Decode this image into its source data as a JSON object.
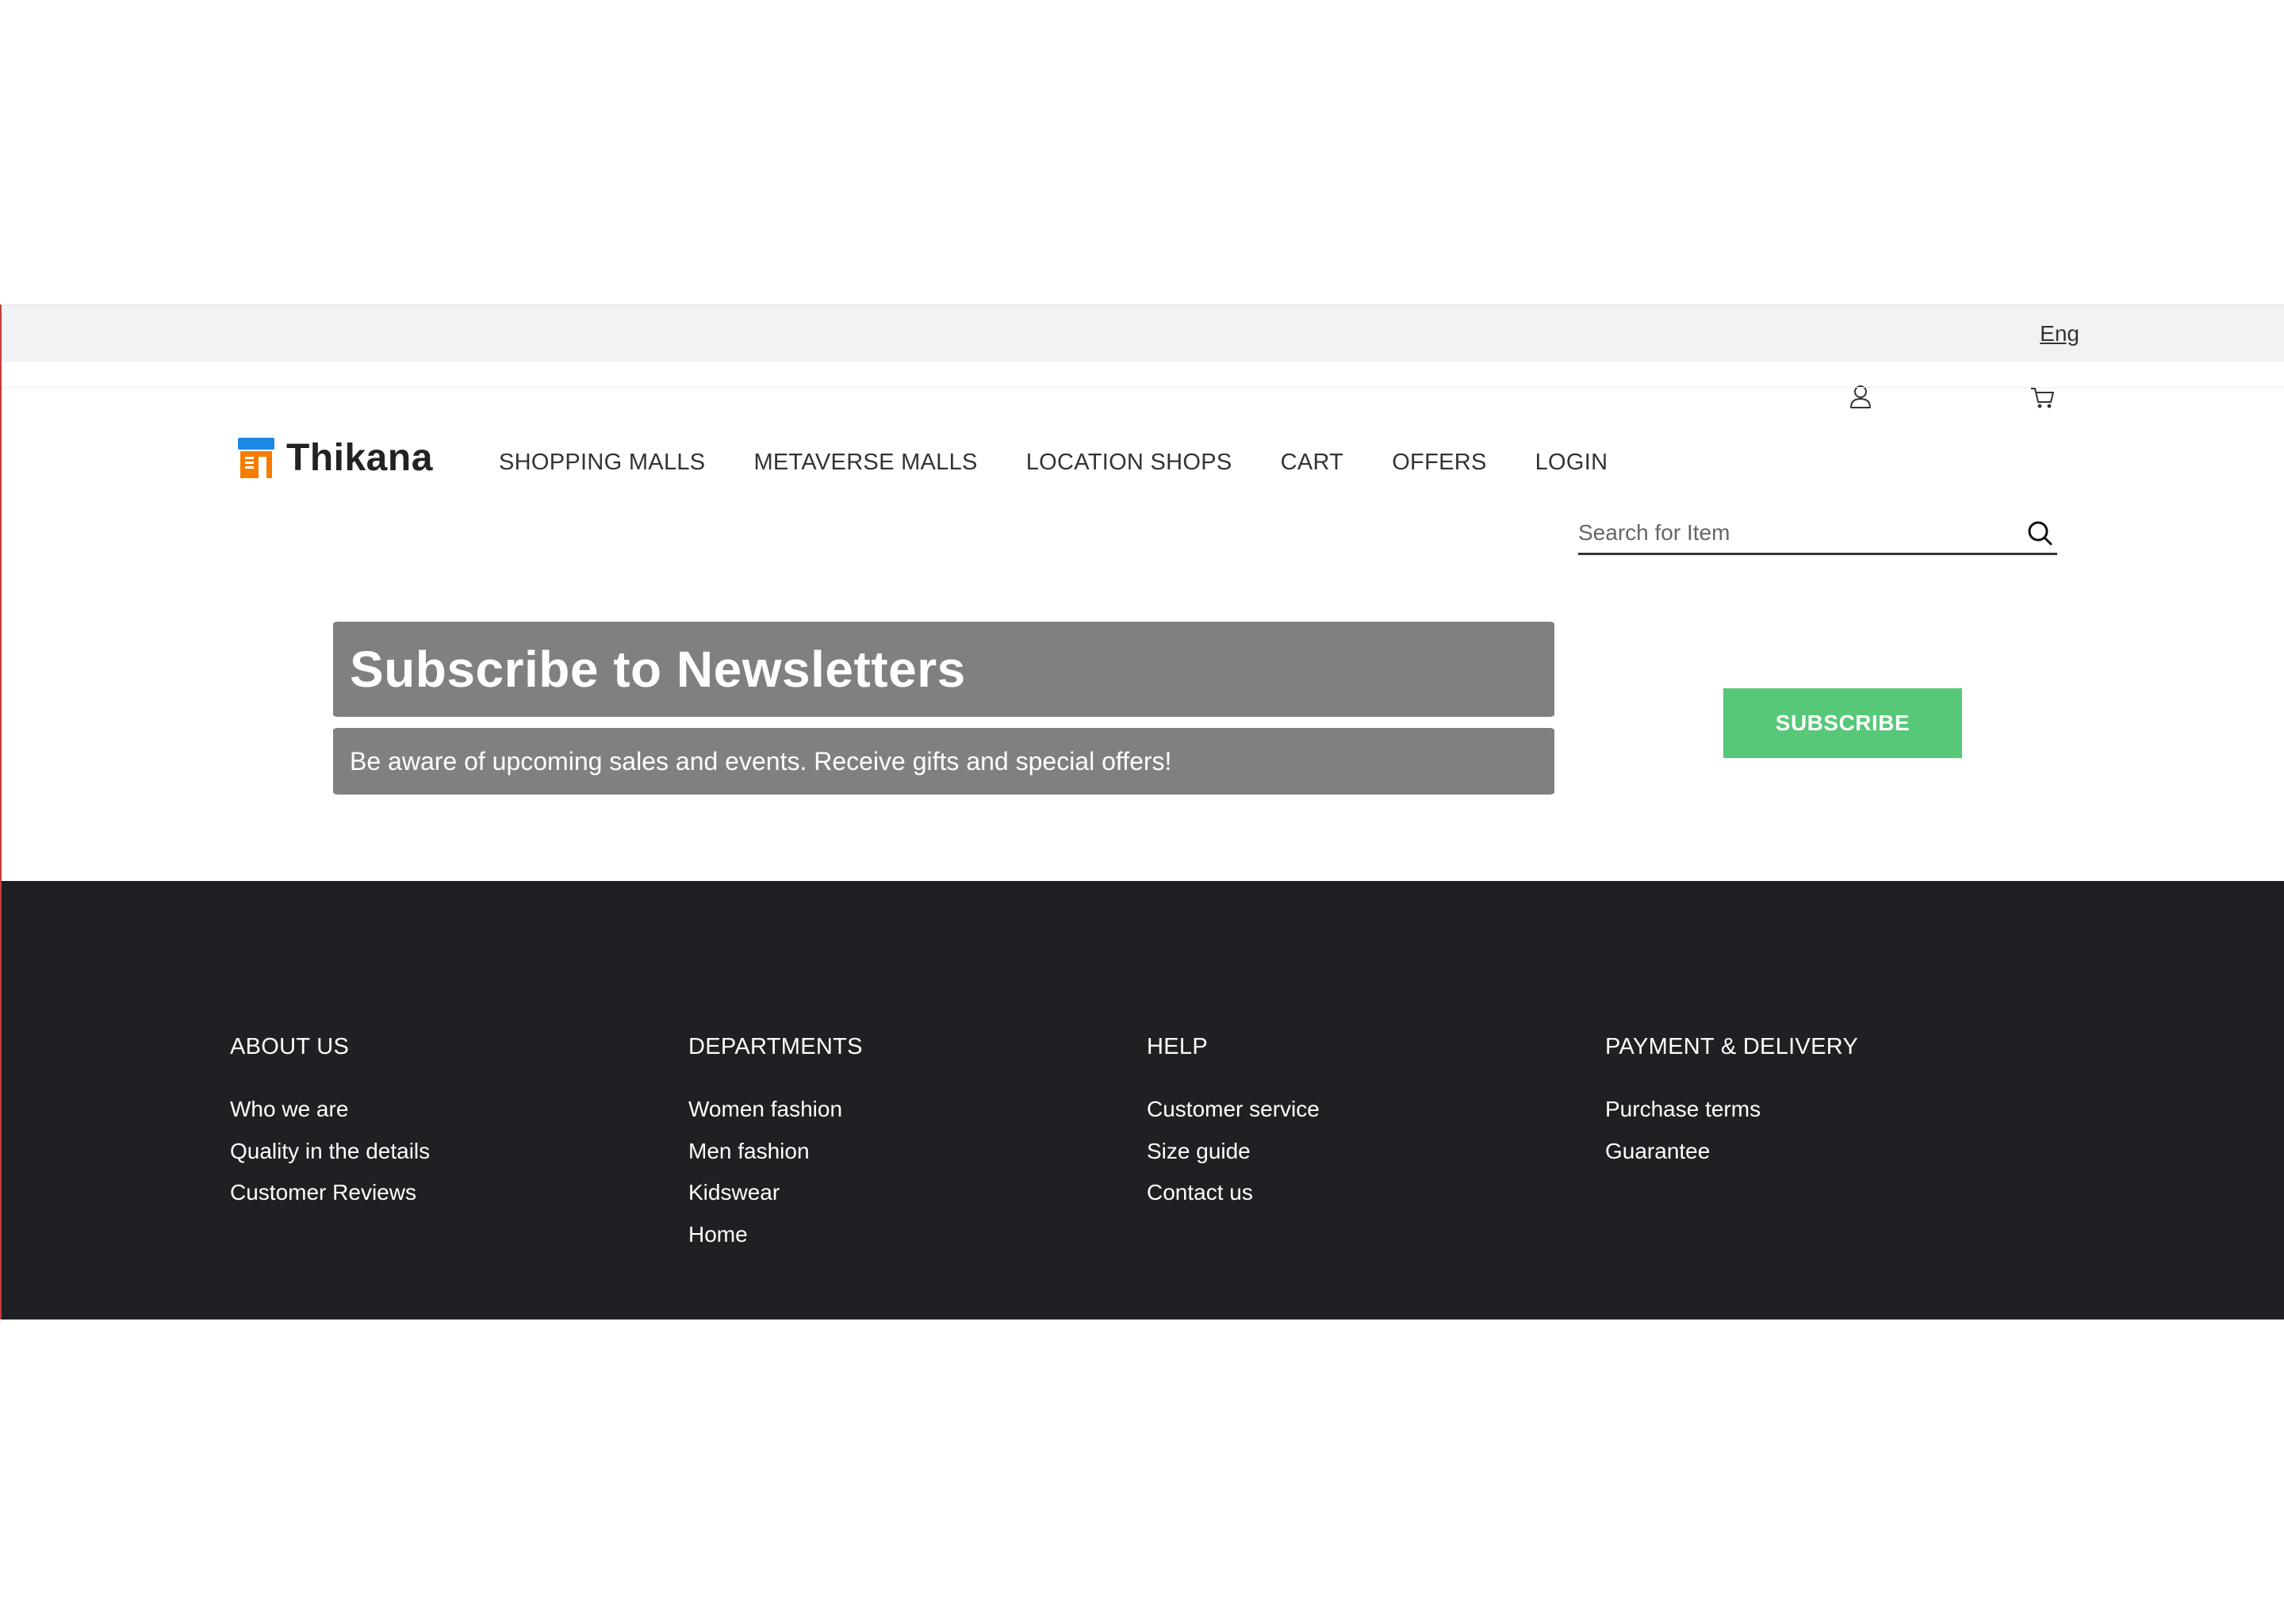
{
  "topbar": {
    "language": "Eng"
  },
  "header": {
    "logo_text": "Thikana",
    "nav": [
      "SHOPPING MALLS",
      "METAVERSE MALLS",
      "LOCATION SHOPS",
      "CART",
      "OFFERS",
      "LOGIN"
    ],
    "search_placeholder": "Search for Item"
  },
  "newsletter": {
    "title": "Subscribe to Newsletters",
    "subtitle": "Be aware of upcoming sales and events. Receive gifts and special offers!",
    "button": "SUBSCRIBE",
    "button_color": "#57c878",
    "banner_color": "#808080"
  },
  "footer": {
    "background": "#1f2023",
    "columns": [
      {
        "heading": "ABOUT US",
        "links": [
          "Who we are",
          "Quality in the details",
          "Customer Reviews"
        ]
      },
      {
        "heading": "DEPARTMENTS",
        "links": [
          "Women fashion",
          "Men fashion",
          "Kidswear",
          "Home"
        ]
      },
      {
        "heading": "HELP",
        "links": [
          "Customer service",
          "Size guide",
          "Contact us"
        ]
      },
      {
        "heading": "PAYMENT & DELIVERY",
        "links": [
          "Purchase terms",
          "Guarantee"
        ]
      }
    ]
  }
}
